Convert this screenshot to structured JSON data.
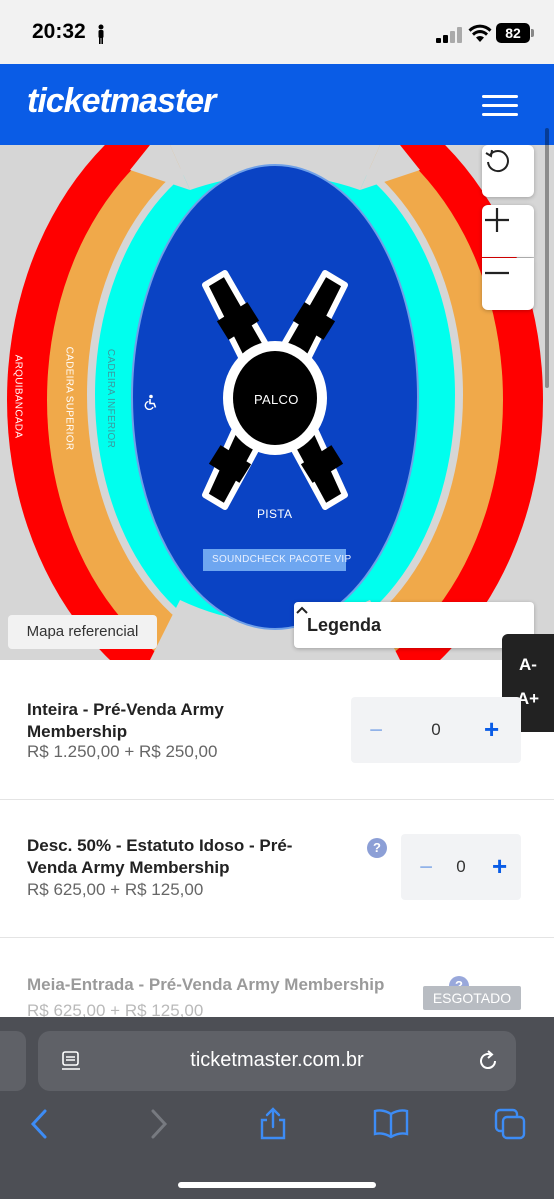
{
  "status_bar": {
    "time": "20:32",
    "battery": "82"
  },
  "header": {
    "logo": "ticketmaster"
  },
  "map": {
    "labels": {
      "arquibancada": "ARQUIBANCADA",
      "cadeira_superior": "CADEIRA SUPERIOR",
      "cadeira_inferior": "CADEIRA INFERIOR",
      "palco": "PALCO",
      "pista": "PISTA",
      "soundcheck": "SOUNDCHECK PACOTE VIP"
    },
    "map_ref": "Mapa referencial",
    "legend": "Legenda",
    "colors": {
      "arquibancada": "#ff0000",
      "cadeira_superior": "#f0a94a",
      "cadeira_inferior": "#00ffee",
      "pista": "#0a43c4"
    }
  },
  "font_widget": {
    "decrease": "A-",
    "increase": "A+"
  },
  "tickets": [
    {
      "title_line1": "Inteira - Pré-Venda Army",
      "title_line2": "Membership",
      "price": "R$ 1.250,00 + R$ 250,00",
      "qty": "0"
    },
    {
      "title_line1": "Desc. 50% - Estatuto Idoso - Pré-",
      "title_line2": "Venda Army Membership",
      "price": "R$ 625,00 + R$ 125,00",
      "qty": "0",
      "help": "?"
    },
    {
      "title_line1": "Meia-Entrada - Pré-Venda Army Membership",
      "price": "R$ 625,00 + R$ 125,00",
      "status": "ESGOTADO",
      "help": "?"
    }
  ],
  "safari": {
    "url": "ticketmaster.com.br"
  }
}
